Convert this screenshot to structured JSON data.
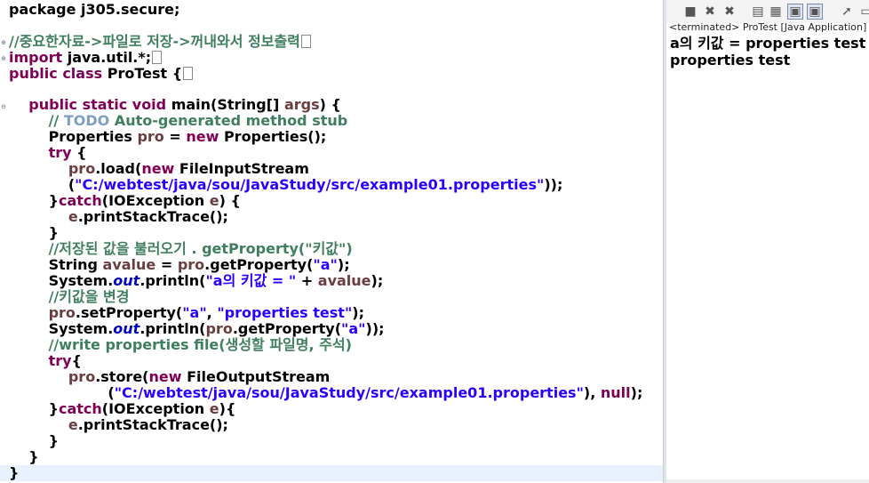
{
  "editor": {
    "lines": [
      [
        [
          "plain",
          "package j305.secure;"
        ]
      ],
      [],
      [
        [
          "cmt",
          "//중요한자료->파일로 저장->꺼내와서 정보출력"
        ],
        [
          "box",
          ""
        ]
      ],
      [
        [
          "kw",
          "import"
        ],
        [
          "plain",
          " java.util.*;"
        ],
        [
          "box",
          ""
        ]
      ],
      [
        [
          "kw",
          "public class"
        ],
        [
          "plain",
          " ProTest "
        ],
        [
          "plain",
          "{"
        ],
        [
          "box",
          ""
        ]
      ],
      [],
      [
        [
          "plain",
          "    "
        ],
        [
          "kw",
          "public static void"
        ],
        [
          "plain",
          " main(String[] "
        ],
        [
          "var",
          "args"
        ],
        [
          "plain",
          ") {"
        ]
      ],
      [
        [
          "plain",
          "        "
        ],
        [
          "cmt",
          "// "
        ],
        [
          "todo",
          "TODO"
        ],
        [
          "cmt",
          " Auto-generated method stub"
        ]
      ],
      [
        [
          "plain",
          "        Properties "
        ],
        [
          "var",
          "pro"
        ],
        [
          "plain",
          " = "
        ],
        [
          "kw",
          "new"
        ],
        [
          "plain",
          " Properties();"
        ]
      ],
      [
        [
          "plain",
          "        "
        ],
        [
          "kw",
          "try"
        ],
        [
          "plain",
          " {"
        ]
      ],
      [
        [
          "plain",
          "            "
        ],
        [
          "var",
          "pro"
        ],
        [
          "plain",
          ".load("
        ],
        [
          "kw",
          "new"
        ],
        [
          "plain",
          " FileInputStream"
        ]
      ],
      [
        [
          "plain",
          "            ("
        ],
        [
          "str",
          "\"C:/webtest/java/sou/JavaStudy/src/example01.properties\""
        ],
        [
          "plain",
          "));"
        ]
      ],
      [
        [
          "plain",
          "        }"
        ],
        [
          "kw",
          "catch"
        ],
        [
          "plain",
          "(IOException "
        ],
        [
          "var",
          "e"
        ],
        [
          "plain",
          ") {"
        ]
      ],
      [
        [
          "plain",
          "            "
        ],
        [
          "var",
          "e"
        ],
        [
          "plain",
          ".printStackTrace();"
        ]
      ],
      [
        [
          "plain",
          "        }"
        ]
      ],
      [
        [
          "plain",
          "        "
        ],
        [
          "cmt",
          "//저장된 값을 불러오기 . getProperty(\"키값\")"
        ]
      ],
      [
        [
          "plain",
          "        String "
        ],
        [
          "var",
          "avalue"
        ],
        [
          "plain",
          " = "
        ],
        [
          "var",
          "pro"
        ],
        [
          "plain",
          ".getProperty("
        ],
        [
          "str",
          "\"a\""
        ],
        [
          "plain",
          ");"
        ]
      ],
      [
        [
          "plain",
          "        System."
        ],
        [
          "fld",
          "out"
        ],
        [
          "plain",
          ".println("
        ],
        [
          "str",
          "\"a의 키값 = \""
        ],
        [
          "plain",
          " + "
        ],
        [
          "var",
          "avalue"
        ],
        [
          "plain",
          ");"
        ]
      ],
      [
        [
          "plain",
          "        "
        ],
        [
          "cmt",
          "//키값을 변경"
        ]
      ],
      [
        [
          "plain",
          "        "
        ],
        [
          "var",
          "pro"
        ],
        [
          "plain",
          ".setProperty("
        ],
        [
          "str",
          "\"a\""
        ],
        [
          "plain",
          ", "
        ],
        [
          "str",
          "\"properties test\""
        ],
        [
          "plain",
          ");"
        ]
      ],
      [
        [
          "plain",
          "        System."
        ],
        [
          "fld",
          "out"
        ],
        [
          "plain",
          ".println("
        ],
        [
          "var",
          "pro"
        ],
        [
          "plain",
          ".getProperty("
        ],
        [
          "str",
          "\"a\""
        ],
        [
          "plain",
          "));"
        ]
      ],
      [
        [
          "plain",
          "        "
        ],
        [
          "cmt",
          "//write properties file(생성할 파일명, 주석)"
        ]
      ],
      [
        [
          "plain",
          "        "
        ],
        [
          "kw",
          "try"
        ],
        [
          "plain",
          "{"
        ]
      ],
      [
        [
          "plain",
          "            "
        ],
        [
          "var",
          "pro"
        ],
        [
          "plain",
          ".store("
        ],
        [
          "kw",
          "new"
        ],
        [
          "plain",
          " FileOutputStream"
        ]
      ],
      [
        [
          "plain",
          "                    ("
        ],
        [
          "str",
          "\"C:/webtest/java/sou/JavaStudy/src/example01.properties\""
        ],
        [
          "plain",
          "), "
        ],
        [
          "kw",
          "null"
        ],
        [
          "plain",
          ");"
        ]
      ],
      [
        [
          "plain",
          "        }"
        ],
        [
          "kw",
          "catch"
        ],
        [
          "plain",
          "(IOException "
        ],
        [
          "var",
          "e"
        ],
        [
          "plain",
          "){"
        ]
      ],
      [
        [
          "plain",
          "            "
        ],
        [
          "var",
          "e"
        ],
        [
          "plain",
          ".printStackTrace();"
        ]
      ],
      [
        [
          "plain",
          "        }"
        ]
      ],
      [
        [
          "plain",
          "    }"
        ]
      ],
      [
        [
          "plain",
          "}"
        ]
      ]
    ]
  },
  "console": {
    "toolbar": [
      {
        "icon": "terminate-icon",
        "glyph": "■"
      },
      {
        "icon": "remove-launch-icon",
        "glyph": "✖"
      },
      {
        "icon": "remove-all-icon",
        "glyph": "✖"
      },
      {
        "icon": "clear-console-icon",
        "glyph": "▤"
      },
      {
        "icon": "scroll-lock-icon",
        "glyph": "▦"
      },
      {
        "icon": "show-stdout-icon",
        "glyph": "▣"
      },
      {
        "icon": "show-stderr-icon",
        "glyph": "▣"
      },
      {
        "icon": "pin-console-icon",
        "glyph": "➚"
      },
      {
        "icon": "display-console-icon",
        "glyph": "▭"
      }
    ],
    "status": "<terminated> ProTest [Java Application] C",
    "output": [
      "a의 키값 = properties test",
      "properties test"
    ]
  }
}
